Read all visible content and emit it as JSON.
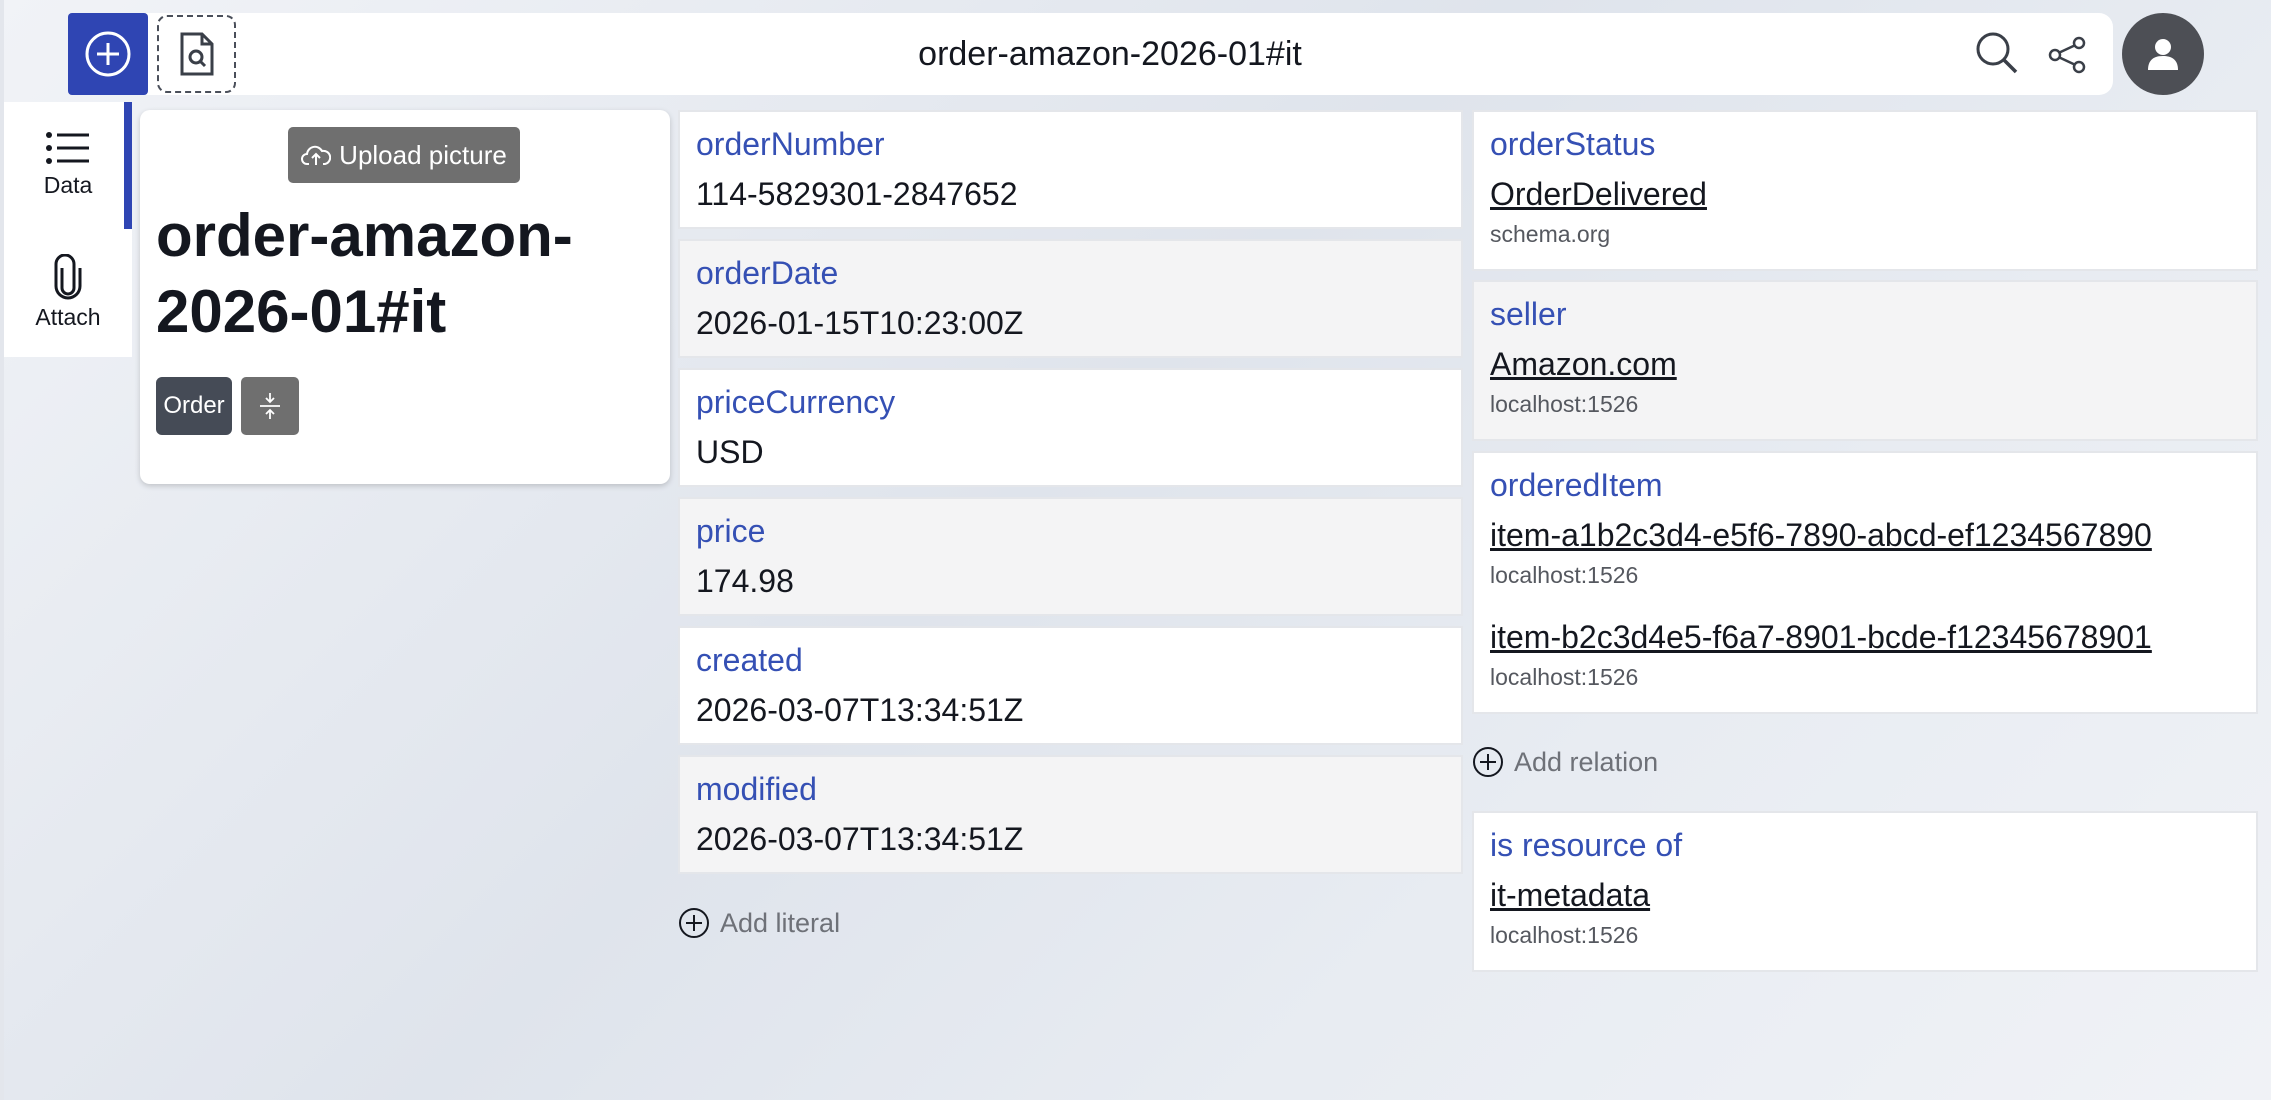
{
  "header": {
    "title": "order-amazon-2026-01#it",
    "new_icon": "plus-circle-icon",
    "doc_icon": "document-search-icon",
    "search_icon": "search-icon",
    "share_icon": "share-icon",
    "avatar_icon": "user-icon"
  },
  "sidebar": {
    "items": [
      {
        "label": "Data",
        "icon": "list-icon"
      },
      {
        "label": "Attach",
        "icon": "paperclip-icon"
      }
    ]
  },
  "card": {
    "upload_label": "Upload picture",
    "title": "order-amazon-2026-01#it",
    "type_chip": "Order"
  },
  "literals": [
    {
      "label": "orderNumber",
      "value": "114-5829301-2847652"
    },
    {
      "label": "orderDate",
      "value": "2026-01-15T10:23:00Z"
    },
    {
      "label": "priceCurrency",
      "value": "USD"
    },
    {
      "label": "price",
      "value": "174.98"
    },
    {
      "label": "created",
      "value": "2026-03-07T13:34:51Z"
    },
    {
      "label": "modified",
      "value": "2026-03-07T13:34:51Z"
    }
  ],
  "add_literal_label": "Add literal",
  "relations": [
    {
      "label": "orderStatus",
      "items": [
        {
          "link": "OrderDelivered",
          "host": "schema.org"
        }
      ]
    },
    {
      "label": "seller",
      "items": [
        {
          "link": "Amazon.com",
          "host": "localhost:1526"
        }
      ]
    },
    {
      "label": "orderedItem",
      "items": [
        {
          "link": "item-a1b2c3d4-e5f6-7890-abcd-ef1234567890",
          "host": "localhost:1526"
        },
        {
          "link": "item-b2c3d4e5-f6a7-8901-bcde-f12345678901",
          "host": "localhost:1526"
        }
      ]
    }
  ],
  "add_relation_label": "Add relation",
  "backlinks": {
    "label": "is resource of",
    "items": [
      {
        "link": "it-metadata",
        "host": "localhost:1526"
      }
    ]
  },
  "colors": {
    "accent": "#2f45b3",
    "label": "#3550b4",
    "chip": "#454b56"
  }
}
